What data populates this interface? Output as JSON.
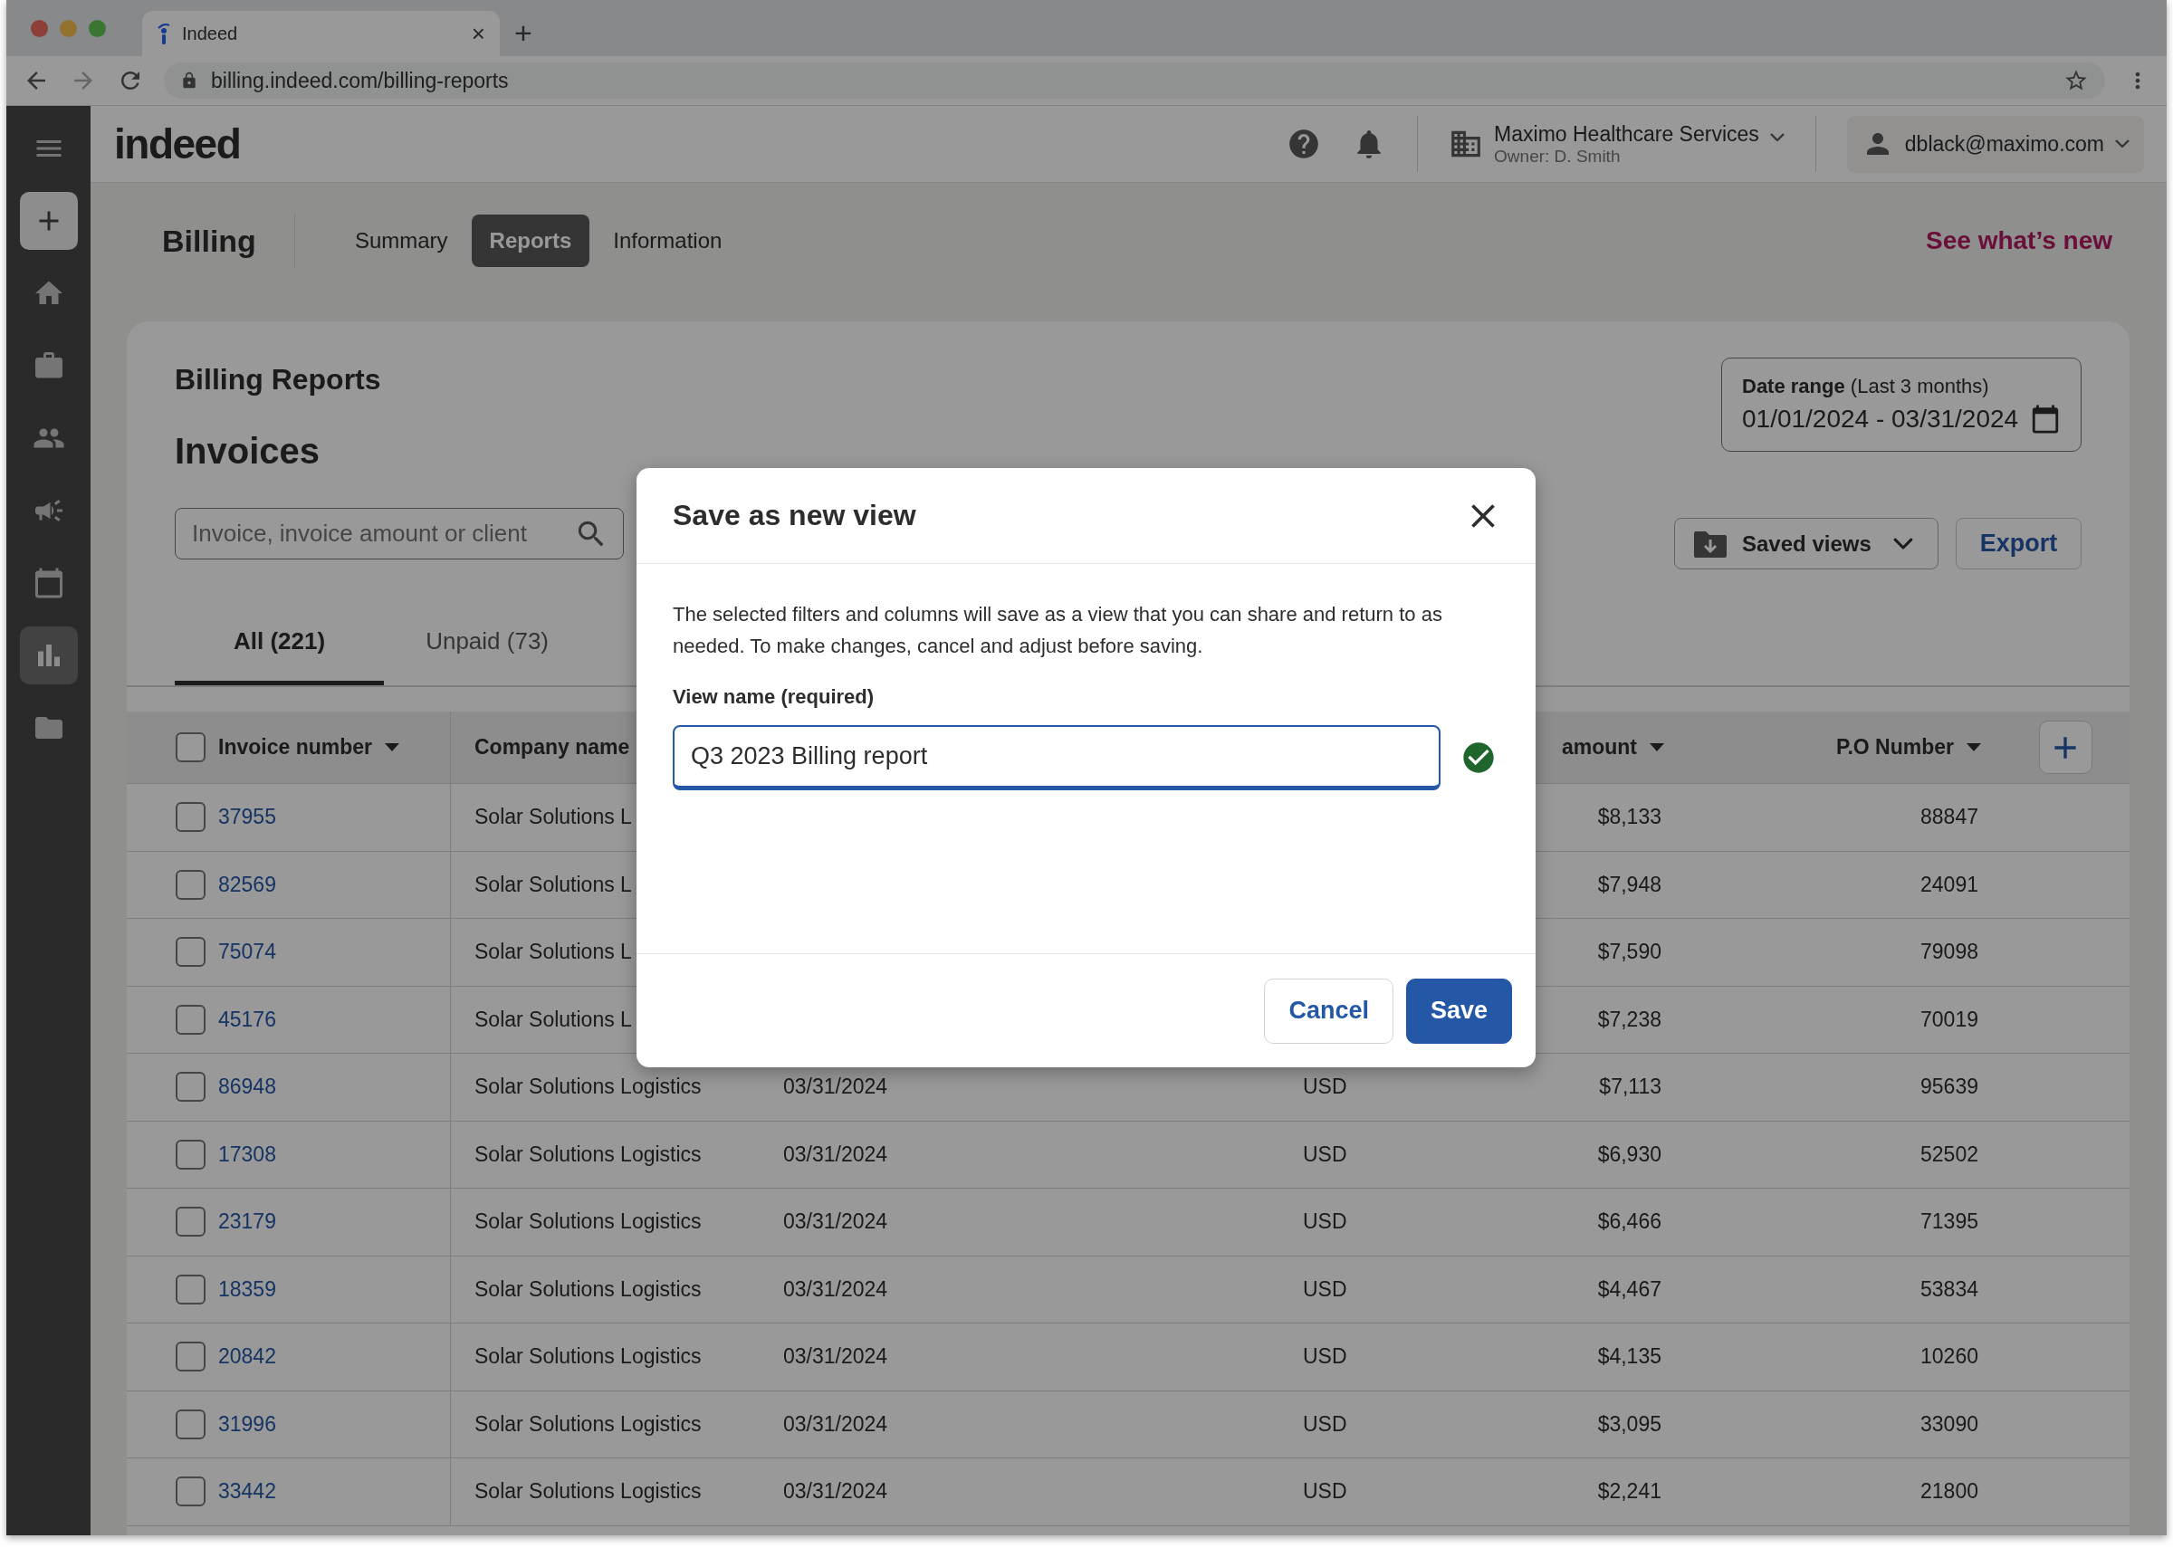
{
  "browser": {
    "tab_title": "Indeed",
    "tab_close": "×",
    "new_tab": "+",
    "url": "billing.indeed.com/billing-reports"
  },
  "sidebar": {
    "items": [
      {
        "kind": "menu",
        "selected": false
      },
      {
        "kind": "add",
        "selected": false
      },
      {
        "kind": "home",
        "selected": false
      },
      {
        "kind": "jobs",
        "selected": false
      },
      {
        "kind": "people",
        "selected": false
      },
      {
        "kind": "campaigns",
        "selected": false
      },
      {
        "kind": "calendar",
        "selected": false
      },
      {
        "kind": "reports",
        "selected": true
      },
      {
        "kind": "folder",
        "selected": false
      }
    ]
  },
  "header": {
    "logo": "indeed",
    "company": "Maximo Healthcare Services",
    "owner": "Owner: D. Smith",
    "user": "dblack@maximo.com"
  },
  "nav": {
    "title": "Billing",
    "tabs": [
      {
        "label": "Summary",
        "selected": false
      },
      {
        "label": "Reports",
        "selected": true
      },
      {
        "label": "Information",
        "selected": false
      }
    ],
    "link": "See what’s new"
  },
  "report": {
    "title": "Billing Reports",
    "heading": "Invoices",
    "search": {
      "placeholder": "Invoice, invoice amount or client"
    },
    "date_range": {
      "label": "**Date range** (Last 3 months)",
      "value": "01/01/2024 - 03/31/2024"
    },
    "saved_views": "Saved views",
    "export": "Export",
    "tabs": [
      {
        "label": "All (221)",
        "selected": true
      },
      {
        "label": "Unpaid (73)",
        "selected": false
      }
    ]
  },
  "table": {
    "select_all": {
      "checked": false
    },
    "columns": [
      {
        "label": "Invoice number",
        "sortable": true
      },
      {
        "label": "Company name",
        "sortable": false
      },
      {
        "label": "amount",
        "sortable": true
      },
      {
        "label": "P.O Number",
        "sortable": true
      }
    ],
    "rows": [
      {
        "checked": false,
        "invoice": "37955",
        "company": "Solar Solutions L",
        "amount": "$8,133",
        "po": "88847"
      },
      {
        "checked": false,
        "invoice": "82569",
        "company": "Solar Solutions L",
        "amount": "$7,948",
        "po": "24091"
      },
      {
        "checked": false,
        "invoice": "75074",
        "company": "Solar Solutions L",
        "amount": "$7,590",
        "po": "79098"
      },
      {
        "checked": false,
        "invoice": "45176",
        "company": "Solar Solutions L",
        "amount": "$7,238",
        "po": "70019"
      },
      {
        "checked": false,
        "invoice": "86948",
        "company": "Solar Solutions Logistics",
        "date": "03/31/2024",
        "currency": "USD",
        "amount": "$7,113",
        "po": "95639"
      },
      {
        "checked": false,
        "invoice": "17308",
        "company": "Solar Solutions Logistics",
        "date": "03/31/2024",
        "currency": "USD",
        "amount": "$6,930",
        "po": "52502"
      },
      {
        "checked": false,
        "invoice": "23179",
        "company": "Solar Solutions Logistics",
        "date": "03/31/2024",
        "currency": "USD",
        "amount": "$6,466",
        "po": "71395"
      },
      {
        "checked": false,
        "invoice": "18359",
        "company": "Solar Solutions Logistics",
        "date": "03/31/2024",
        "currency": "USD",
        "amount": "$4,467",
        "po": "53834"
      },
      {
        "checked": false,
        "invoice": "20842",
        "company": "Solar Solutions Logistics",
        "date": "03/31/2024",
        "currency": "USD",
        "amount": "$4,135",
        "po": "10260"
      },
      {
        "checked": false,
        "invoice": "31996",
        "company": "Solar Solutions Logistics",
        "date": "03/31/2024",
        "currency": "USD",
        "amount": "$3,095",
        "po": "33090"
      },
      {
        "checked": false,
        "invoice": "33442",
        "company": "Solar Solutions Logistics",
        "date": "03/31/2024",
        "currency": "USD",
        "amount": "$2,241",
        "po": "21800"
      }
    ]
  },
  "modal": {
    "title": "Save as new view",
    "text": "The selected filters and columns will save as a view that you can share and return to as needed. To make changes, cancel and adjust before saving.",
    "field_label": "View name (required)",
    "value": "Q3 2023 Billing report",
    "valid": true,
    "buttons": [
      {
        "label": "Cancel",
        "kind": "secondary"
      },
      {
        "label": "Save",
        "kind": "primary"
      }
    ]
  }
}
